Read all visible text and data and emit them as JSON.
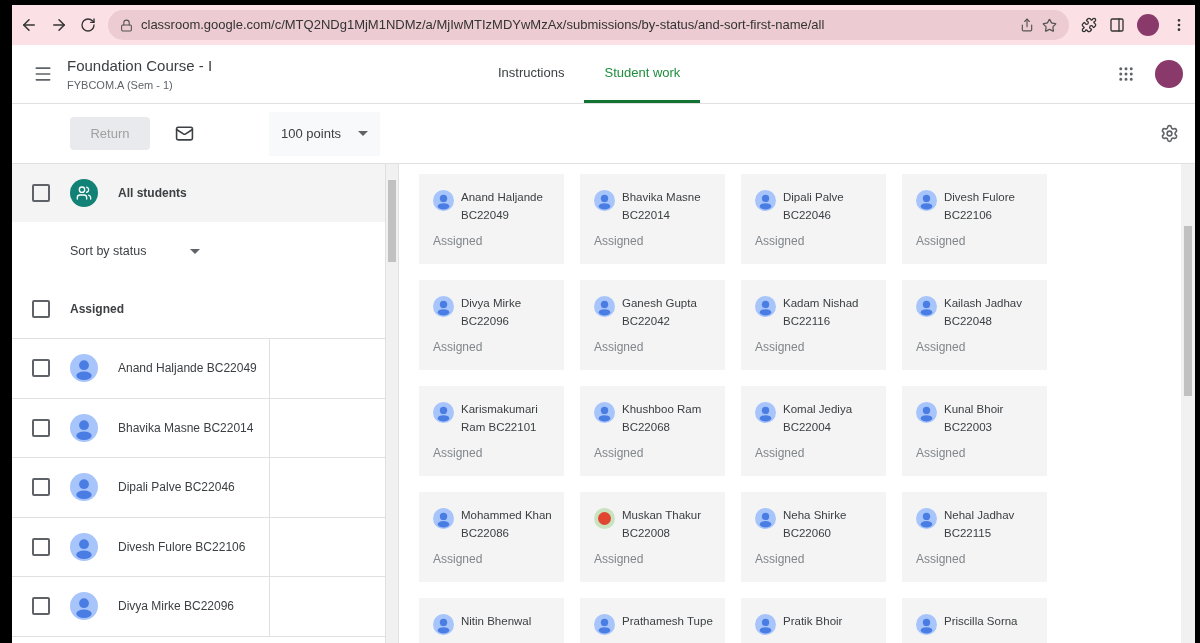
{
  "browser": {
    "url": "classroom.google.com/c/MTQ2NDg1MjM1NDMz/a/MjIwMTIzMDYwMzAx/submissions/by-status/and-sort-first-name/all"
  },
  "header": {
    "title": "Foundation Course - I",
    "subtitle": "FYBCOM.A (Sem - 1)"
  },
  "tabs": [
    {
      "label": "Instructions",
      "selected": false
    },
    {
      "label": "Student work",
      "selected": true
    }
  ],
  "toolbar": {
    "return_button": "Return",
    "return_disabled": true,
    "points": "100 points"
  },
  "sidebar": {
    "all_students": {
      "label": "All students",
      "checked": false
    },
    "sort": "Sort by status",
    "group": {
      "label": "Assigned",
      "checked": false
    },
    "students": [
      {
        "name": "Anand Haljande BC22049",
        "checked": false
      },
      {
        "name": "Bhavika Masne BC22014",
        "checked": false
      },
      {
        "name": "Dipali Palve BC22046",
        "checked": false
      },
      {
        "name": "Divesh Fulore BC22106",
        "checked": false
      },
      {
        "name": "Divya Mirke BC22096",
        "checked": false
      }
    ]
  },
  "cards": [
    {
      "name": "Anand Haljande",
      "id": "BC22049",
      "status": "Assigned"
    },
    {
      "name": "Bhavika Masne",
      "id": "BC22014",
      "status": "Assigned"
    },
    {
      "name": "Dipali Palve",
      "id": "BC22046",
      "status": "Assigned"
    },
    {
      "name": "Divesh Fulore",
      "id": "BC22106",
      "status": "Assigned"
    },
    {
      "name": "Divya Mirke",
      "id": "BC22096",
      "status": "Assigned"
    },
    {
      "name": "Ganesh Gupta",
      "id": "BC22042",
      "status": "Assigned"
    },
    {
      "name": "Kadam Nishad",
      "id": "BC22116",
      "status": "Assigned"
    },
    {
      "name": "Kailash Jadhav",
      "id": "BC22048",
      "status": "Assigned"
    },
    {
      "name": "Karismakumari Ram BC22101",
      "status": "Assigned"
    },
    {
      "name": "Khushboo Ram",
      "id": "BC22068",
      "status": "Assigned"
    },
    {
      "name": "Komal Jediya",
      "id": "BC22004",
      "status": "Assigned"
    },
    {
      "name": "Kunal Bhoir",
      "id": "BC22003",
      "status": "Assigned"
    },
    {
      "name": "Mohammed Khan",
      "id": "BC22086",
      "status": "Assigned"
    },
    {
      "name": "Muskan Thakur",
      "id": "BC22008",
      "status": "Assigned",
      "kind": "photo"
    },
    {
      "name": "Neha Shirke",
      "id": "BC22060",
      "status": "Assigned"
    },
    {
      "name": "Nehal Jadhav",
      "id": "BC22115",
      "status": "Assigned"
    },
    {
      "name": "Nitin Bhenwal"
    },
    {
      "name": "Prathamesh Tupe"
    },
    {
      "name": "Pratik Bhoir"
    },
    {
      "name": "Priscilla Sorna"
    }
  ]
}
